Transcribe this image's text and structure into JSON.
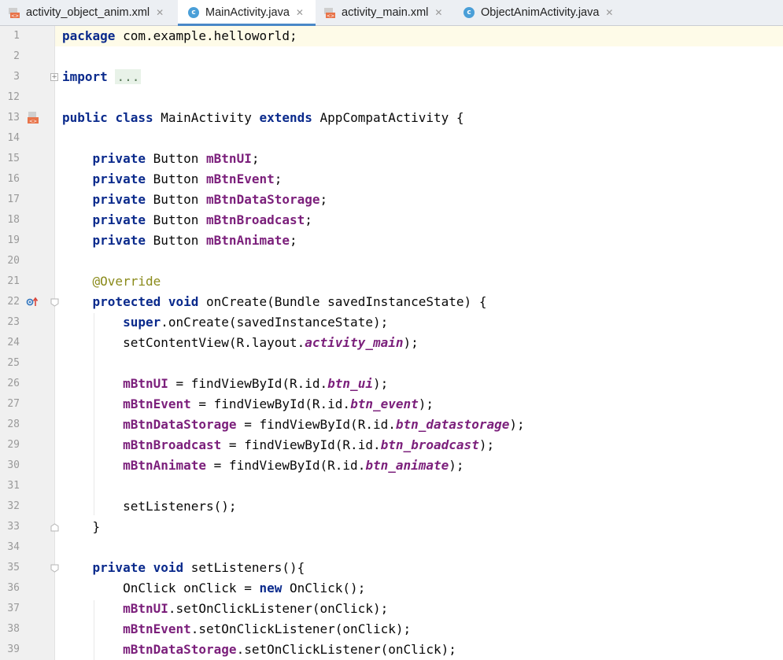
{
  "tabs": [
    {
      "label": "activity_object_anim.xml",
      "icon": "xml-file-icon",
      "active": false
    },
    {
      "label": "MainActivity.java",
      "icon": "java-class-icon",
      "active": true
    },
    {
      "label": "activity_main.xml",
      "icon": "xml-file-icon",
      "active": false
    },
    {
      "label": "ObjectAnimActivity.java",
      "icon": "java-class-icon",
      "active": false
    }
  ],
  "close_glyph": "✕",
  "class_icon_letter": "c",
  "colors": {
    "keyword": "#0a2a8c",
    "field": "#7b1f7b",
    "annotation": "#8a8a1a",
    "active_tab_underline": "#4a88c7",
    "current_line_highlight": "#fefbe8"
  },
  "editor": {
    "lines": [
      {
        "num": "1",
        "text": "package com.example.helloworld;"
      },
      {
        "num": "2",
        "text": ""
      },
      {
        "num": "3",
        "text": "import ..."
      },
      {
        "num": "12",
        "text": ""
      },
      {
        "num": "13",
        "text": "public class MainActivity extends AppCompatActivity {"
      },
      {
        "num": "14",
        "text": ""
      },
      {
        "num": "15",
        "text": "    private Button mBtnUI;"
      },
      {
        "num": "16",
        "text": "    private Button mBtnEvent;"
      },
      {
        "num": "17",
        "text": "    private Button mBtnDataStorage;"
      },
      {
        "num": "18",
        "text": "    private Button mBtnBroadcast;"
      },
      {
        "num": "19",
        "text": "    private Button mBtnAnimate;"
      },
      {
        "num": "20",
        "text": ""
      },
      {
        "num": "21",
        "text": "    @Override"
      },
      {
        "num": "22",
        "text": "    protected void onCreate(Bundle savedInstanceState) {"
      },
      {
        "num": "23",
        "text": "        super.onCreate(savedInstanceState);"
      },
      {
        "num": "24",
        "text": "        setContentView(R.layout.activity_main);"
      },
      {
        "num": "25",
        "text": ""
      },
      {
        "num": "26",
        "text": "        mBtnUI = findViewById(R.id.btn_ui);"
      },
      {
        "num": "27",
        "text": "        mBtnEvent = findViewById(R.id.btn_event);"
      },
      {
        "num": "28",
        "text": "        mBtnDataStorage = findViewById(R.id.btn_datastorage);"
      },
      {
        "num": "29",
        "text": "        mBtnBroadcast = findViewById(R.id.btn_broadcast);"
      },
      {
        "num": "30",
        "text": "        mBtnAnimate = findViewById(R.id.btn_animate);"
      },
      {
        "num": "31",
        "text": ""
      },
      {
        "num": "32",
        "text": "        setListeners();"
      },
      {
        "num": "33",
        "text": "    }"
      },
      {
        "num": "34",
        "text": ""
      },
      {
        "num": "35",
        "text": "    private void setListeners(){"
      },
      {
        "num": "36",
        "text": "        OnClick onClick = new OnClick();"
      },
      {
        "num": "37",
        "text": "        mBtnUI.setOnClickListener(onClick);"
      },
      {
        "num": "38",
        "text": "        mBtnEvent.setOnClickListener(onClick);"
      },
      {
        "num": "39",
        "text": "        mBtnDataStorage.setOnClickListener(onClick);"
      }
    ]
  }
}
